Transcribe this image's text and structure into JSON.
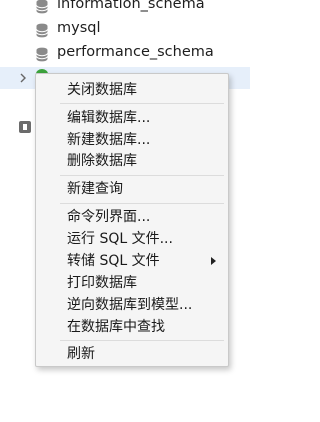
{
  "tree": {
    "databases": [
      {
        "label": "information_schema",
        "icon": "database-icon"
      },
      {
        "label": "mysql",
        "icon": "database-icon"
      },
      {
        "label": "performance_schema",
        "icon": "database-icon"
      }
    ],
    "selected_icon": "database-open-icon"
  },
  "context_menu": {
    "items": [
      {
        "label": "关闭数据库"
      },
      {
        "label": "编辑数据库..."
      },
      {
        "label": "新建数据库..."
      },
      {
        "label": "删除数据库"
      },
      {
        "label": "新建查询"
      },
      {
        "label": "命令列界面..."
      },
      {
        "label": "运行 SQL 文件..."
      },
      {
        "label": "转储 SQL 文件",
        "has_submenu": true
      },
      {
        "label": "打印数据库"
      },
      {
        "label": "逆向数据库到模型..."
      },
      {
        "label": "在数据库中查找"
      },
      {
        "label": "刷新"
      }
    ]
  },
  "colors": {
    "menu_background": "#f5f5f5",
    "selection_highlight": "#e6effa",
    "database_icon": "#8a8a8a",
    "open_database_icon": "#3ca33c"
  }
}
